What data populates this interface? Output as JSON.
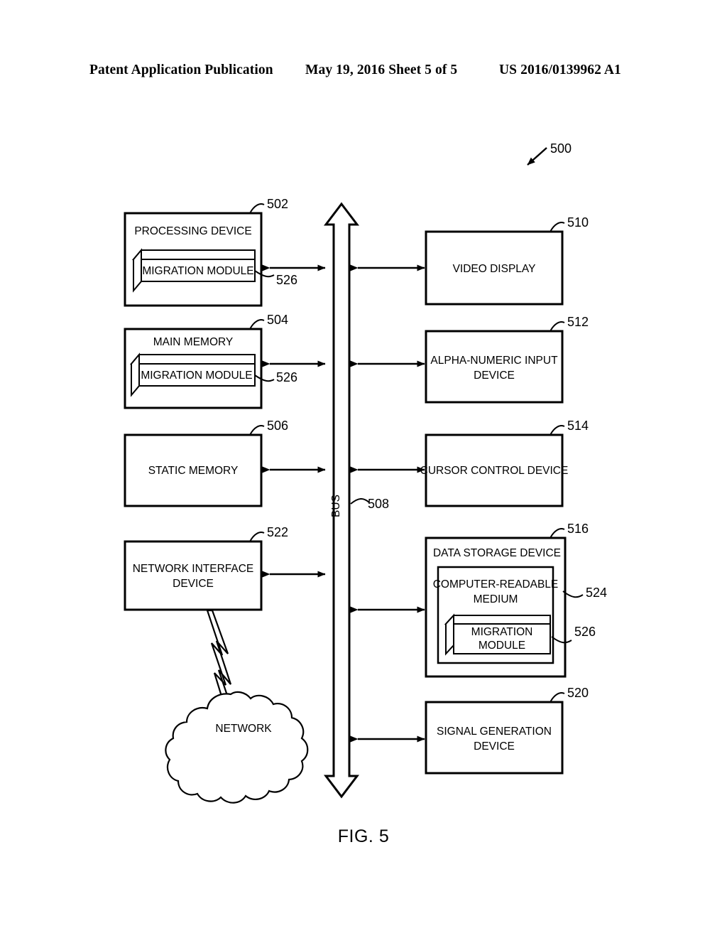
{
  "header": {
    "left": "Patent Application Publication",
    "middle": "May 19, 2016  Sheet 5 of 5",
    "right": "US 2016/0139962 A1"
  },
  "figure": {
    "caption": "FIG. 5",
    "system_ref": "500",
    "bus_label": "BUS",
    "bus_ref": "508"
  },
  "nodes": {
    "processing_device": {
      "label": "PROCESSING DEVICE",
      "ref": "502",
      "module": {
        "label": "MIGRATION MODULE",
        "ref": "526"
      }
    },
    "main_memory": {
      "label": "MAIN MEMORY",
      "ref": "504",
      "module": {
        "label": "MIGRATION MODULE",
        "ref": "526"
      }
    },
    "static_memory": {
      "label": "STATIC MEMORY",
      "ref": "506"
    },
    "network_interface_device": {
      "label_line1": "NETWORK INTERFACE",
      "label_line2": "DEVICE",
      "ref": "522"
    },
    "network_cloud": {
      "label": "NETWORK"
    },
    "video_display": {
      "label": "VIDEO DISPLAY",
      "ref": "510"
    },
    "alpha_numeric_input_device": {
      "label_line1": "ALPHA-NUMERIC INPUT",
      "label_line2": "DEVICE",
      "ref": "512"
    },
    "cursor_control_device": {
      "label": "CURSOR CONTROL DEVICE",
      "ref": "514"
    },
    "data_storage_device": {
      "label": "DATA STORAGE DEVICE",
      "ref": "516",
      "medium": {
        "label_line1": "COMPUTER-READABLE",
        "label_line2": "MEDIUM",
        "ref": "524"
      },
      "module": {
        "label_line1": "MIGRATION",
        "label_line2": "MODULE",
        "ref": "526"
      }
    },
    "signal_generation_device": {
      "label_line1": "SIGNAL GENERATION",
      "label_line2": "DEVICE",
      "ref": "520"
    }
  },
  "colors": {
    "ink": "#000000",
    "paper": "#ffffff"
  }
}
